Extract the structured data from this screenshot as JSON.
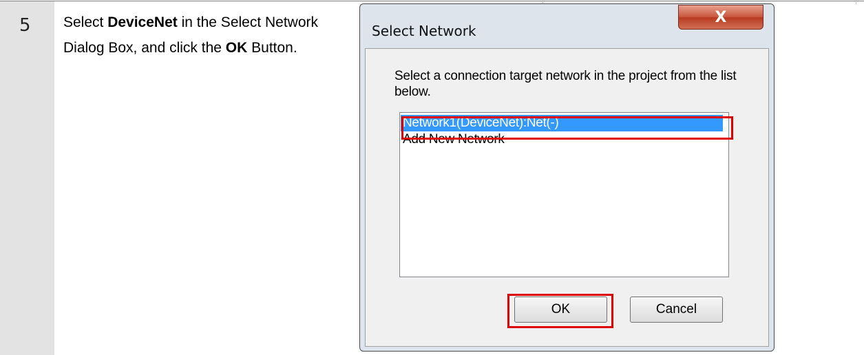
{
  "step": {
    "number": "5",
    "text_parts": [
      "Select ",
      "DeviceNet",
      " in the Select Network Dialog Box, and click the ",
      "OK",
      " Button."
    ]
  },
  "dialog": {
    "title": "Select Network",
    "close_glyph": "X",
    "prompt": "Select a connection target network in the project from the list below.",
    "list_items": [
      "Network1(DeviceNet):Net(-)",
      "Add New Network"
    ],
    "selected_index": 0,
    "ok_label": "OK",
    "cancel_label": "Cancel"
  },
  "colors": {
    "highlight": "#e00000",
    "selection": "#3399ff",
    "step_column": "#e3e3e3"
  }
}
